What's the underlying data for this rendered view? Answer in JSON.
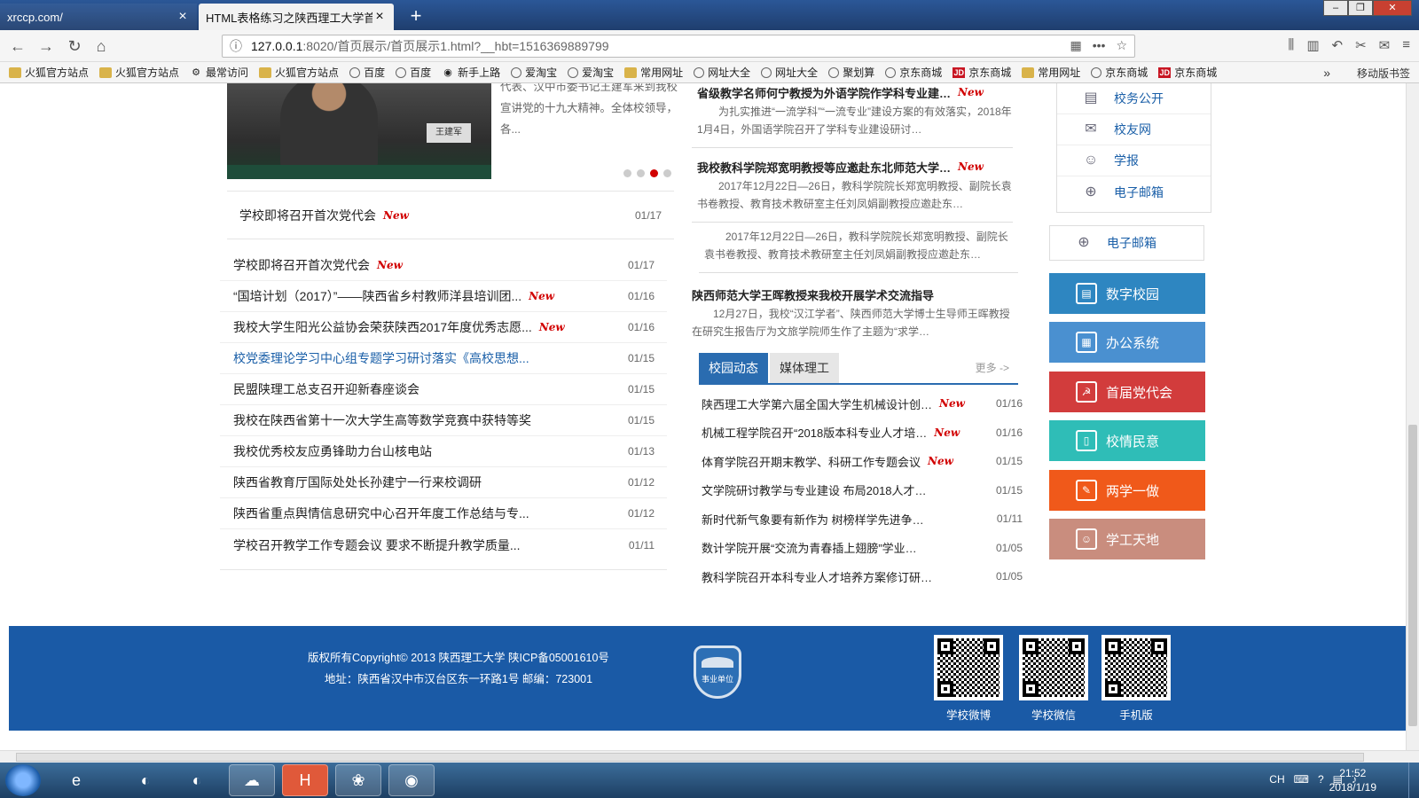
{
  "browser": {
    "tabs": [
      {
        "title": "xrccp.com/"
      },
      {
        "title": "HTML表格练习之陕西理工大学首页"
      }
    ],
    "url_host": "127.0.0.1",
    "url_path": ":8020/首页展示/首页展示1.html?__hbt=1516369889799",
    "bookmarks": [
      {
        "label": "火狐官方站点",
        "icon": "folder-icon"
      },
      {
        "label": "火狐官方站点",
        "icon": "folder-icon"
      },
      {
        "label": "最常访问",
        "icon": "gear-icon"
      },
      {
        "label": "火狐官方站点",
        "icon": "folder-icon"
      },
      {
        "label": "百度",
        "icon": "globe-icon"
      },
      {
        "label": "百度",
        "icon": "globe-icon"
      },
      {
        "label": "新手上路",
        "icon": "firefox-icon"
      },
      {
        "label": "爱淘宝",
        "icon": "globe-icon"
      },
      {
        "label": "爱淘宝",
        "icon": "globe-icon"
      },
      {
        "label": "常用网址",
        "icon": "folder-icon"
      },
      {
        "label": "网址大全",
        "icon": "globe-icon"
      },
      {
        "label": "网址大全",
        "icon": "globe-icon"
      },
      {
        "label": "聚划算",
        "icon": "globe-icon"
      },
      {
        "label": "京东商城",
        "icon": "globe-icon"
      },
      {
        "label": "京东商城",
        "icon": "jd-icon"
      },
      {
        "label": "常用网址",
        "icon": "folder-icon"
      },
      {
        "label": "京东商城",
        "icon": "globe-icon"
      },
      {
        "label": "京东商城",
        "icon": "jd-icon"
      }
    ],
    "bookmarks_more": "»",
    "mobile_bookmarks": "移动版书签"
  },
  "page": {
    "photo_nameplate": "王建军",
    "photo_caption": "代表、汉中市委书记王建军来到我校宣讲党的十九大精神。全体校领导，各...",
    "headline": {
      "title": "学校即将召开首次党代会",
      "badge": "New",
      "date": "01/17"
    },
    "news": [
      {
        "title": "学校即将召开首次党代会",
        "badge": "New",
        "date": "01/17"
      },
      {
        "title": "“国培计划（2017）”——陕西省乡村教师洋县培训团...",
        "badge": "New",
        "date": "01/16"
      },
      {
        "title": "我校大学生阳光公益协会荣获陕西2017年度优秀志愿...",
        "badge": "New",
        "date": "01/16"
      },
      {
        "title": "校党委理论学习中心组专题学习研讨落实《高校思想...",
        "badge": "",
        "date": "01/15",
        "link": true
      },
      {
        "title": "民盟陕理工总支召开迎新春座谈会",
        "badge": "",
        "date": "01/15"
      },
      {
        "title": "我校在陕西省第十一次大学生高等数学竞赛中获特等奖",
        "badge": "",
        "date": "01/15"
      },
      {
        "title": "我校优秀校友应勇锋助力台山核电站",
        "badge": "",
        "date": "01/13"
      },
      {
        "title": "陕西省教育厅国际处处长孙建宁一行来校调研",
        "badge": "",
        "date": "01/12"
      },
      {
        "title": "陕西省重点舆情信息研究中心召开年度工作总结与专...",
        "badge": "",
        "date": "01/12"
      },
      {
        "title": "学校召开教学工作专题会议 要求不断提升教学质量...",
        "badge": "",
        "date": "01/11"
      }
    ],
    "articles": [
      {
        "title": "省级教学名师何宁教授为外语学院作学科专业建…",
        "badge": "New",
        "body": "为扎实推进“一流学科”“一流专业”建设方案的有效落实，2018年1月4日，外国语学院召开了学科专业建设研讨…"
      },
      {
        "title": "我校教科学院郑宽明教授等应邀赴东北师范大学…",
        "badge": "New",
        "body": "2017年12月22日—26日，教科学院院长郑宽明教授、副院长袁书卷教授、教育技术教研室主任刘凤娟副教授应邀赴东…"
      }
    ],
    "article_dup_body": "2017年12月22日—26日，教科学院院长郑宽明教授、副院长袁书卷教授、教育技术教研室主任刘凤娟副教授应邀赴东…",
    "article_last": {
      "title": "陕西师范大学王晖教授来我校开展学术交流指导",
      "body": "12月27日，我校“汉江学者”、陕西师范大学博士生导师王晖教授在研究生报告厅为文旅学院师生作了主题为“求学…"
    },
    "tabs": {
      "active": "校园动态",
      "inactive": "媒体理工",
      "more": "更多 ->"
    },
    "campus_news": [
      {
        "title": "陕西理工大学第六届全国大学生机械设计创…",
        "badge": "New",
        "date": "01/16"
      },
      {
        "title": "机械工程学院召开“2018版本科专业人才培…",
        "badge": "New",
        "date": "01/16"
      },
      {
        "title": "体育学院召开期末教学、科研工作专题会议",
        "badge": "New",
        "date": "01/15"
      },
      {
        "title": "文学院研讨教学与专业建设 布局2018人才…",
        "badge": "",
        "date": "01/15"
      },
      {
        "title": "新时代新气象要有新作为 树榜样学先进争…",
        "badge": "",
        "date": "01/11"
      },
      {
        "title": "数计学院开展“交流为青春插上翅膀”学业…",
        "badge": "",
        "date": "01/05"
      },
      {
        "title": "教科学院召开本科专业人才培养方案修订研…",
        "badge": "",
        "date": "01/05"
      }
    ],
    "quick_links": [
      {
        "label": "校务公开",
        "icon": "document-icon"
      },
      {
        "label": "校友网",
        "icon": "mail-icon"
      },
      {
        "label": "学报",
        "icon": "user-icon"
      },
      {
        "label": "电子邮箱",
        "icon": "globe-icon"
      }
    ],
    "quick_link_extra": "电子邮箱",
    "side_buttons": [
      {
        "label": "数字校园",
        "icon": "digital-campus-icon",
        "color": "#2e86c1"
      },
      {
        "label": "办公系统",
        "icon": "calendar-icon",
        "color": "#4a90d0"
      },
      {
        "label": "首届党代会",
        "icon": "party-emblem-icon",
        "color": "#d23c3c"
      },
      {
        "label": "校情民意",
        "icon": "book-icon",
        "color": "#2fbdb7"
      },
      {
        "label": "两学一做",
        "icon": "user-edit-icon",
        "color": "#f0591a"
      },
      {
        "label": "学工天地",
        "icon": "users-icon",
        "color": "#c98d7e"
      }
    ],
    "footer": {
      "copyright": "版权所有Copyright© 2013 陕西理工大学    陕ICP备05001610号",
      "address": "地址：陕西省汉中市汉台区东一环路1号     邮编：723001",
      "badge_text": "事业单位",
      "qr": [
        {
          "label": "学校微博"
        },
        {
          "label": "学校微信"
        },
        {
          "label": "手机版"
        }
      ]
    }
  },
  "taskbar": {
    "lang": "CH",
    "time": "21:52",
    "date": "2018/1/19"
  },
  "colors": {
    "accent": "#2a6cb0",
    "new_badge": "#d10000",
    "footer": "#1a5aa6"
  }
}
